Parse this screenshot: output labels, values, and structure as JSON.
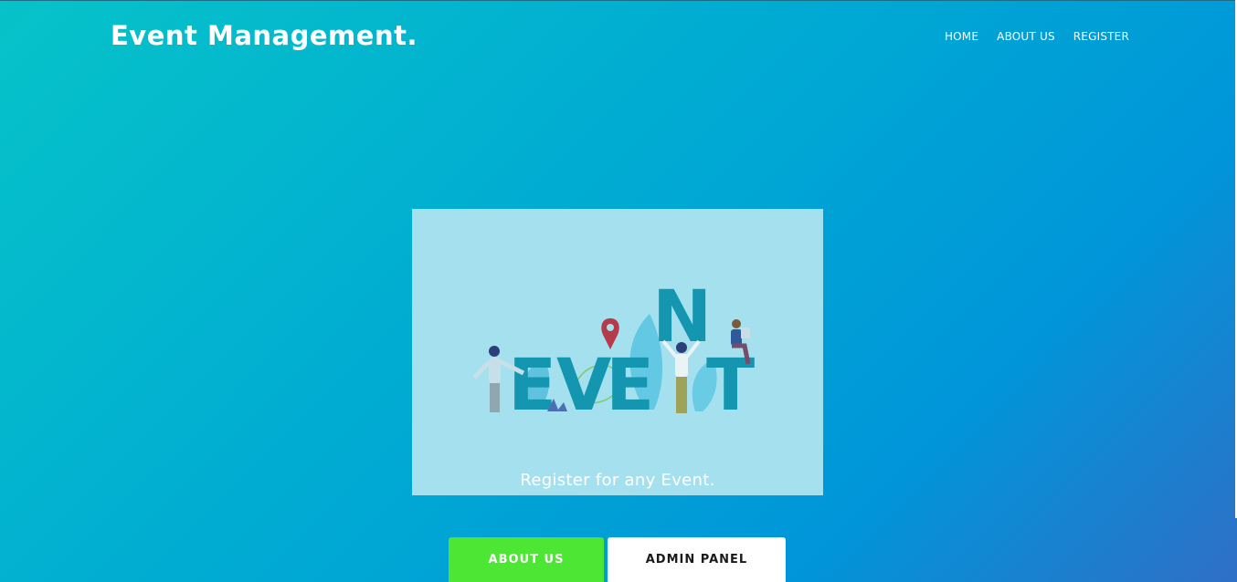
{
  "brand": {
    "title": "Event Management."
  },
  "nav": {
    "items": [
      {
        "label": "HOME"
      },
      {
        "label": "ABOUT US"
      },
      {
        "label": "REGISTER"
      }
    ]
  },
  "hero": {
    "illustration_text": "EVENT",
    "illustration_letters": [
      "E",
      "V",
      "E",
      "N",
      "T"
    ],
    "tagline": "Register for any Event."
  },
  "buttons": {
    "about_label": "ABOUT US",
    "admin_label": "ADMIN PANEL"
  },
  "colors": {
    "background_start": "#06c3c8",
    "background_end": "#2f6fc7",
    "card": "#a5e0ee",
    "letters": "#1496b0",
    "pin": "#b53a4a",
    "about_button": "#4ee634",
    "admin_button": "#ffffff"
  }
}
